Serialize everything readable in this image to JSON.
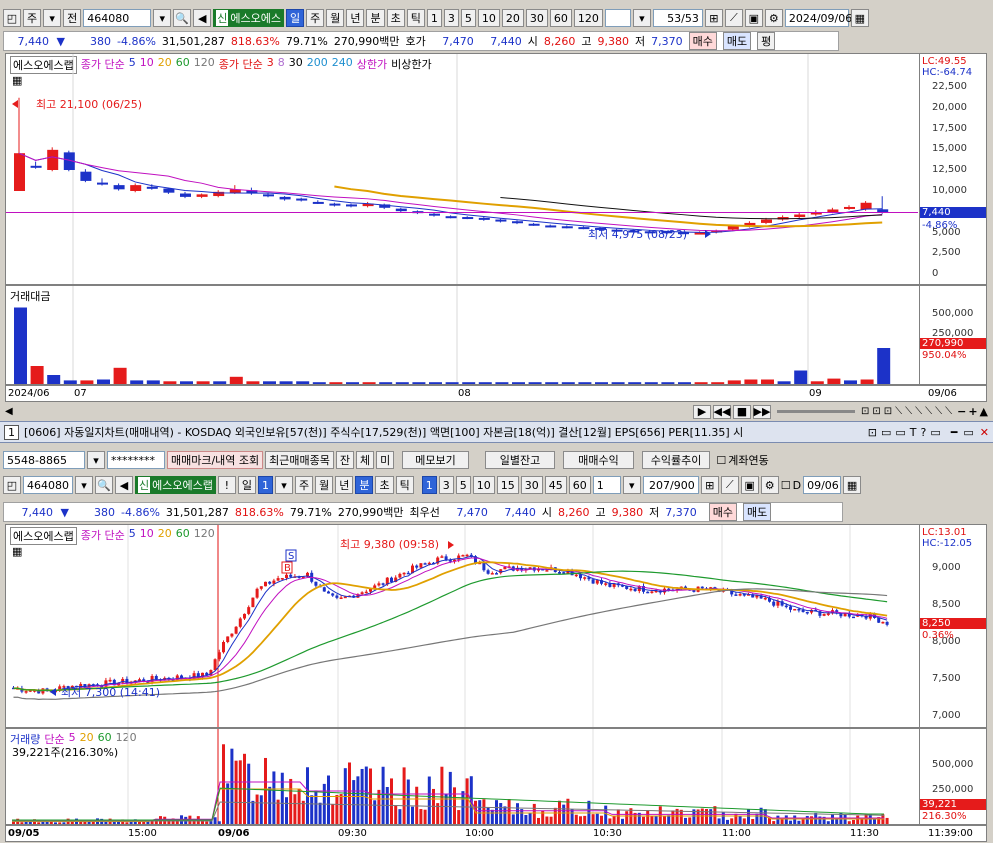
{
  "top": {
    "toolbar": {
      "market": "주",
      "period_mode": "전",
      "code": "464080",
      "name": "에스오에스",
      "tf": [
        "일",
        "주",
        "월",
        "년",
        "분",
        "초",
        "틱"
      ],
      "tf_sel": "일",
      "nums": [
        "1",
        "3",
        "5",
        "10",
        "20",
        "30",
        "60",
        "120"
      ],
      "count": "53/53",
      "date": "2024/09/06"
    },
    "quote": {
      "price": "7,440",
      "change": "380",
      "rate": "-4.86%",
      "volume": "31,501,287",
      "turnover": "818.63%",
      "ratio": "79.71%",
      "amount": "270,990백만",
      "ask_label": "호가",
      "ask": "7,470",
      "bid": "7,440",
      "open_l": "시",
      "open": "8,260",
      "high_l": "고",
      "high": "9,380",
      "low_l": "저",
      "low": "7,370",
      "buy": "매수",
      "sell": "매도",
      "eval": "평"
    },
    "legend": {
      "name": "에스오에스랩",
      "ma_label": "종가 단순",
      "ma": [
        "5",
        "10",
        "20",
        "60",
        "120"
      ],
      "ma2_label": "종가 단순",
      "ma2": [
        "3",
        "8",
        "30",
        "200",
        "240"
      ],
      "upper": "상한가",
      "nonupper": "비상한가"
    },
    "axis": {
      "lc": "LC:49.55",
      "hc": "HC:-64.74",
      "ticks": [
        "22,500",
        "20,000",
        "17,500",
        "15,000",
        "12,500",
        "10,000",
        "7,500",
        "5,000",
        "2,500",
        "0"
      ],
      "price_box": "7,440",
      "price_rate": "-4.86%"
    },
    "notes": {
      "high": "최고 21,100 (06/25)",
      "low": "최저 4,975 (08/23)"
    },
    "vol": {
      "label": "거래대금",
      "ticks": [
        "500,000",
        "250,000"
      ],
      "box": "270,990",
      "rate": "950.04%",
      "dates": [
        "2024/06",
        "07",
        "08",
        "09",
        "09/06"
      ]
    }
  },
  "titlebar": {
    "num": "1",
    "text": "[0606] 자동일지차트(매매내역) - KOSDAQ 외국인보유[57(천)] 주식수[17,529(천)] 액면[100] 자본금[18(억)] 결산[12월] EPS[656] PER[11.35] 시"
  },
  "bot": {
    "acct": {
      "account": "5548-8865",
      "password": "********",
      "btns": [
        "매매마크/내역 조회",
        "최근매매종목",
        "잔",
        "체",
        "미",
        "메모보기",
        "일별잔고",
        "매매수익",
        "수익률추이"
      ],
      "link": "계좌연동"
    },
    "toolbar": {
      "code": "464080",
      "name": "에스오에스랩",
      "tf": [
        "일",
        "1",
        "주",
        "월",
        "년",
        "분",
        "초",
        "틱"
      ],
      "tf_sel": "분",
      "nums": [
        "1",
        "3",
        "5",
        "10",
        "15",
        "30",
        "45",
        "60"
      ],
      "unit": "1",
      "count": "207/900",
      "d_label": "D",
      "date": "09/06"
    },
    "quote": {
      "price": "7,440",
      "change": "380",
      "rate": "-4.86%",
      "volume": "31,501,287",
      "turnover": "818.63%",
      "ratio": "79.71%",
      "amount": "270,990백만",
      "ask_label": "최우선",
      "ask": "7,470",
      "bid": "7,440",
      "open_l": "시",
      "open": "8,260",
      "high_l": "고",
      "high": "9,380",
      "low_l": "저",
      "low": "7,370",
      "buy": "매수",
      "sell": "매도"
    },
    "legend": {
      "name": "에스오에스랩",
      "ma_label": "종가 단순",
      "ma": [
        "5",
        "10",
        "20",
        "60",
        "120"
      ]
    },
    "axis": {
      "lc": "LC:13.01",
      "hc": "HC:-12.05",
      "ticks": [
        "9,000",
        "8,500",
        "8,000",
        "7,500",
        "7,000"
      ],
      "price_box": "8,250",
      "price_rate": "0.36%"
    },
    "notes": {
      "high": "최고 9,380 (09:58)",
      "low": "최저 7,300 (14:41)",
      "s": "S",
      "b": "B"
    },
    "vol": {
      "label": "거래량",
      "ma_label": "단순",
      "ma": [
        "5",
        "20",
        "60",
        "120"
      ],
      "sub": "39,221주(216.30%)",
      "ticks": [
        "500,000",
        "250,000"
      ],
      "box": "39,221",
      "rate": "216.30%"
    },
    "times": [
      "09/05",
      "15:00",
      "09/06",
      "09:30",
      "10:00",
      "10:30",
      "11:00",
      "11:30",
      "11:39:00"
    ]
  },
  "colors": {
    "up": "#e51b1b",
    "down": "#1c32c8",
    "ma5": "#1c32c8",
    "ma10": "#c010c0",
    "ma20": "#e0a000",
    "ma60": "#1e9a2e",
    "ma120": "#777777",
    "accent": "#2f64d8"
  }
}
